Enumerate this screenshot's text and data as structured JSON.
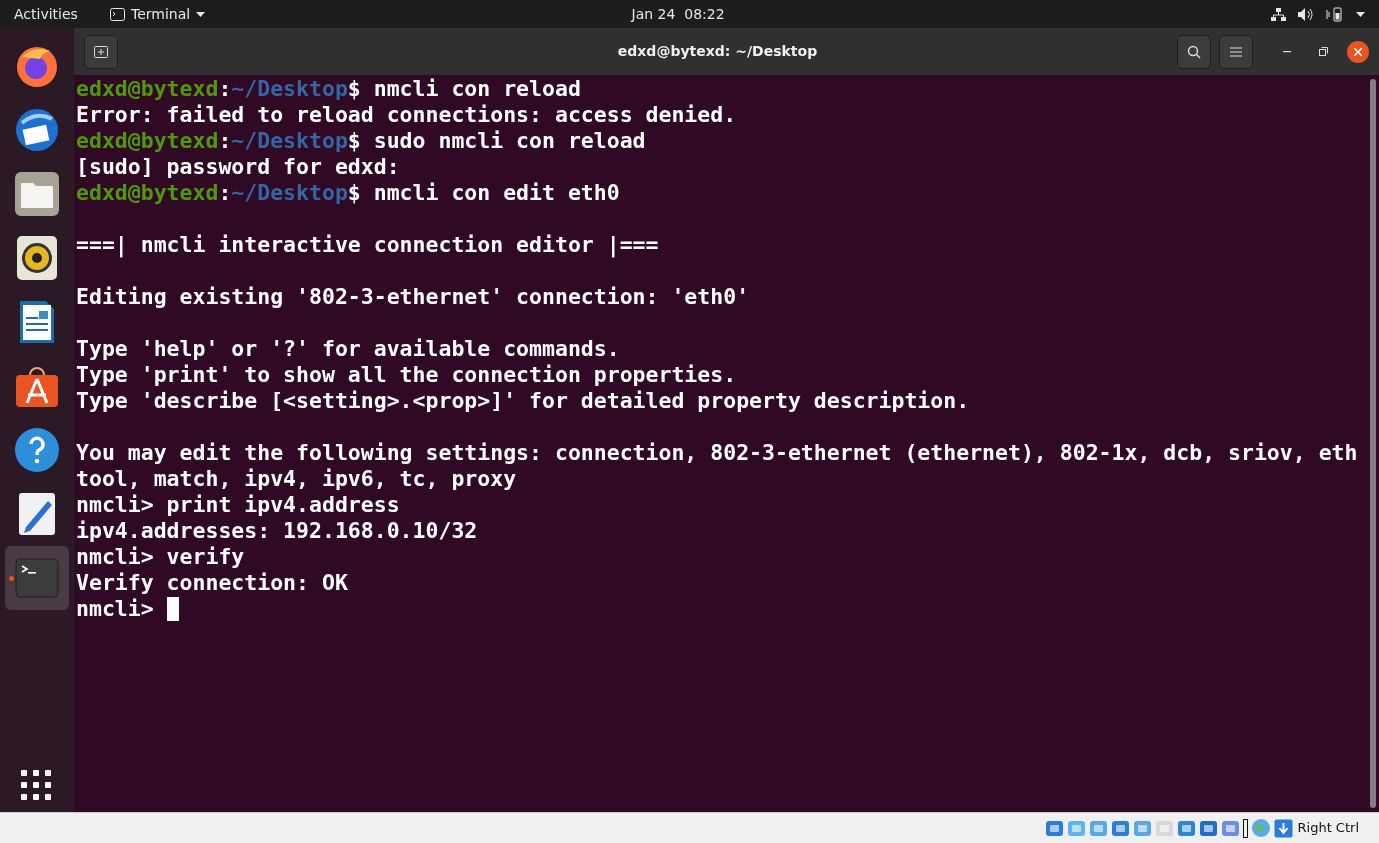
{
  "top_bar": {
    "activities": "Activities",
    "app_menu": "Terminal",
    "clock": "Jan 24  08:22"
  },
  "dock": [
    {
      "kind": "browser",
      "selected": false
    },
    {
      "kind": "mail",
      "selected": false
    },
    {
      "kind": "files",
      "selected": false
    },
    {
      "kind": "music",
      "selected": false
    },
    {
      "kind": "document",
      "selected": false
    },
    {
      "kind": "store",
      "selected": false
    },
    {
      "kind": "help",
      "selected": false
    },
    {
      "kind": "editor",
      "selected": false
    },
    {
      "kind": "terminal",
      "selected": true
    }
  ],
  "window": {
    "title": "edxd@bytexd: ~/Desktop"
  },
  "terminal": {
    "lines": [
      {
        "kind": "prompt",
        "user": "edxd@bytexd",
        "sep": ":",
        "path": "~/Desktop",
        "command": "$ nmcli con reload"
      },
      {
        "kind": "output",
        "text": "Error: failed to reload connections: access denied."
      },
      {
        "kind": "prompt",
        "user": "edxd@bytexd",
        "sep": ":",
        "path": "~/Desktop",
        "command": "$ sudo nmcli con reload"
      },
      {
        "kind": "output",
        "text": "[sudo] password for edxd:"
      },
      {
        "kind": "prompt",
        "user": "edxd@bytexd",
        "sep": ":",
        "path": "~/Desktop",
        "command": "$ nmcli con edit eth0"
      },
      {
        "kind": "blank"
      },
      {
        "kind": "output",
        "text": "===| nmcli interactive connection editor |==="
      },
      {
        "kind": "blank"
      },
      {
        "kind": "output",
        "text": "Editing existing '802-3-ethernet' connection: 'eth0'"
      },
      {
        "kind": "blank"
      },
      {
        "kind": "output",
        "text": "Type 'help' or '?' for available commands."
      },
      {
        "kind": "output",
        "text": "Type 'print' to show all the connection properties."
      },
      {
        "kind": "output",
        "text": "Type 'describe [<setting>.<prop>]' for detailed property description."
      },
      {
        "kind": "blank"
      },
      {
        "kind": "output",
        "text": "You may edit the following settings: connection, 802-3-ethernet (ethernet), 802-1x, dcb, sriov, eth"
      },
      {
        "kind": "output",
        "text": "tool, match, ipv4, ipv6, tc, proxy"
      },
      {
        "kind": "output",
        "text": "nmcli> print ipv4.address"
      },
      {
        "kind": "output",
        "text": "ipv4.addresses: 192.168.0.10/32"
      },
      {
        "kind": "output",
        "text": "nmcli> verify"
      },
      {
        "kind": "output",
        "text": "Verify connection: OK"
      },
      {
        "kind": "input",
        "text": "nmcli> "
      }
    ]
  },
  "status_bar": {
    "host_key": "Right Ctrl"
  }
}
